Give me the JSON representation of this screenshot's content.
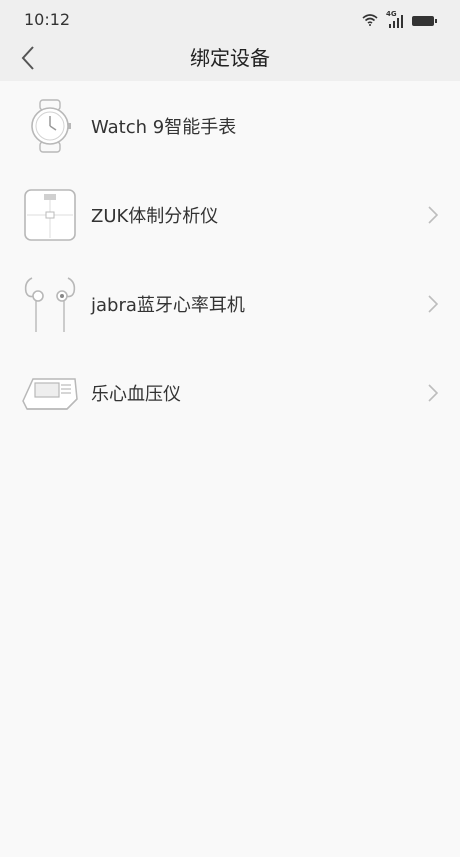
{
  "status_bar": {
    "time": "10:12",
    "network_label": "4G",
    "icons": [
      "wifi-icon",
      "signal-icon",
      "battery-icon"
    ]
  },
  "header": {
    "title": "绑定设备",
    "back_icon": "chevron-left-icon"
  },
  "devices": [
    {
      "label": "Watch 9智能手表",
      "icon": "watch-icon",
      "has_chevron": false
    },
    {
      "label": "ZUK体制分析仪",
      "icon": "scale-icon",
      "has_chevron": true
    },
    {
      "label": "jabra蓝牙心率耳机",
      "icon": "earphones-icon",
      "has_chevron": true
    },
    {
      "label": "乐心血压仪",
      "icon": "blood-pressure-monitor-icon",
      "has_chevron": true
    }
  ],
  "colors": {
    "header_bg": "#efefef",
    "page_bg": "#f9f9f9",
    "text": "#333333",
    "icon_stroke": "#b8b8b8",
    "chevron": "#bdbdbd"
  }
}
